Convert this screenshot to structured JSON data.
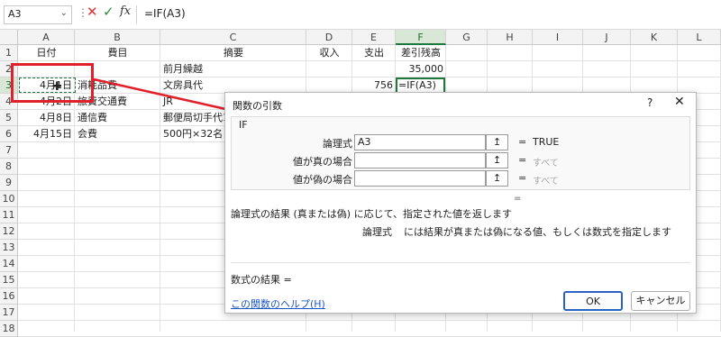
{
  "namebox": {
    "value": "A3",
    "dropdown_icon": "chevron-down-icon"
  },
  "formula_bar": {
    "cancel_icon": "cancel-icon",
    "enter_icon": "enter-icon",
    "fx_label": "fx",
    "content": "=IF(A3)"
  },
  "columns": [
    "A",
    "B",
    "C",
    "D",
    "E",
    "F",
    "G",
    "H",
    "I",
    "J",
    "K",
    "L"
  ],
  "rows": [
    "1",
    "2",
    "3",
    "4",
    "5",
    "6",
    "7",
    "8",
    "9",
    "10",
    "11",
    "12",
    "13",
    "14",
    "15",
    "16",
    "17",
    "18"
  ],
  "cells": {
    "A1": "日付",
    "B1": "費目",
    "C1": "摘要",
    "D1": "収入",
    "E1": "支出",
    "F1": "差引残高",
    "C2": "前月繰越",
    "F2": "35,000",
    "A3": "4月1日",
    "B3": "消耗品費",
    "C3": "文房具代",
    "E3": "756",
    "F3": "=IF(A3)",
    "A4": "4月2日",
    "B4": "旅費交通費",
    "C4": "JR",
    "A5": "4月8日",
    "B5": "通信費",
    "C5": "郵便局切手代1",
    "A6": "4月15日",
    "B6": "会費",
    "C6": "500円×32名"
  },
  "dialog": {
    "title": "関数の引数",
    "help_label": "?",
    "close_label": "✕",
    "function_name": "IF",
    "args": [
      {
        "label": "論理式",
        "value": "A3",
        "result": "TRUE"
      },
      {
        "label": "値が真の場合",
        "value": "",
        "result": "すべて"
      },
      {
        "label": "値が偽の場合",
        "value": "",
        "result": "すべて"
      }
    ],
    "ref_icon": "↥",
    "equals": "=",
    "description": "論理式の結果 (真または偽) に応じて、指定された値を返します",
    "arg_description_name": "論理式",
    "arg_description_text": "には結果が真または偽になる値、もしくは数式を指定します",
    "formula_result_label": "数式の結果 =",
    "help_link": "この関数のヘルプ(H)",
    "ok_label": "OK",
    "cancel_label": "キャンセル"
  },
  "colors": {
    "annotation": "#e0202a",
    "selection": "#1e7a3c",
    "link": "#1a56c8"
  }
}
